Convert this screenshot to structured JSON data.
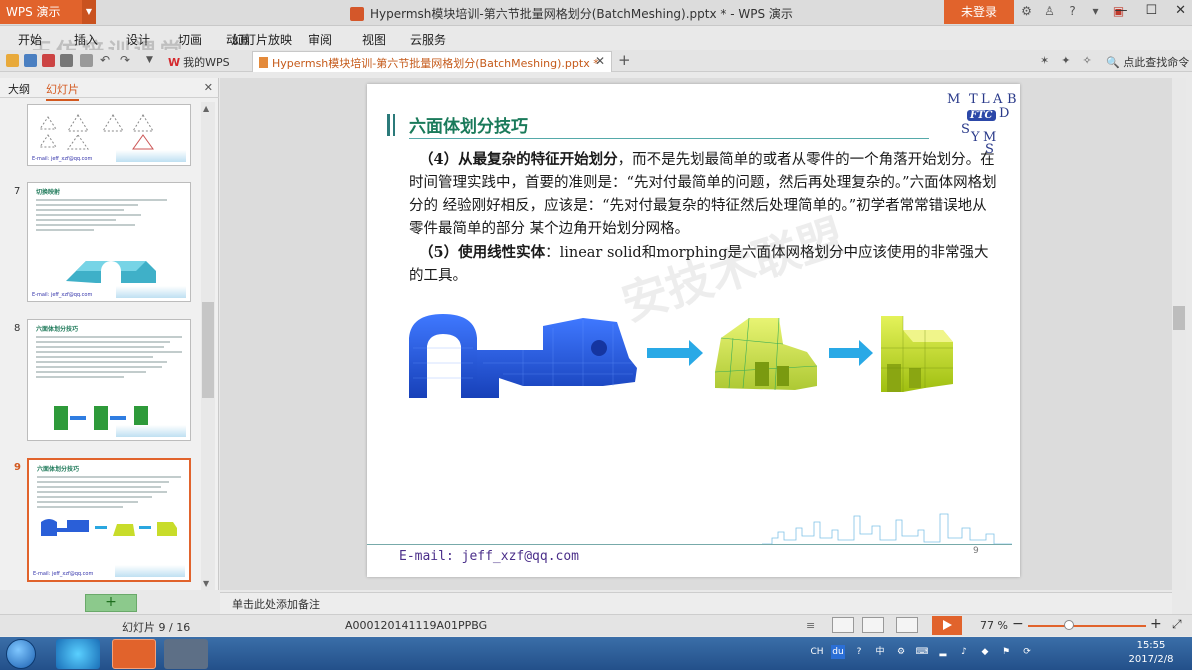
{
  "window": {
    "app_button": "WPS 演示",
    "title": "Hypermsh模块培训-第六节批量网格划分(BatchMeshing).pptx * - WPS 演示",
    "login": "未登录",
    "controls": [
      "—",
      "☐",
      "✕"
    ]
  },
  "menu": {
    "items": [
      "开始",
      "插入",
      "设计",
      "切画",
      "动画",
      "幻灯片放映",
      "审阅",
      "视图",
      "云服务"
    ],
    "watermark": "王仿培训课堂"
  },
  "tabs": {
    "home": "我的WPS",
    "doc": "Hypermsh模块培训-第六节批量网格划分(BatchMeshing).pptx *",
    "search_cmd": "点此查找命令"
  },
  "left_panel": {
    "tab_outline": "大纲",
    "tab_slides": "幻灯片",
    "thumbnails": [
      {
        "num": "",
        "title": "",
        "footer": "E-mail: jeff_xzf@qq.com"
      },
      {
        "num": "7",
        "title": "切换映射",
        "footer": "E-mail: jeff_xzf@qq.com"
      },
      {
        "num": "8",
        "title": "六面体划分技巧",
        "footer": "E-mail: jeff_xzf@qq.com"
      },
      {
        "num": "9",
        "title": "六面体划分技巧",
        "footer": "E-mail: jeff_xzf@qq.com"
      }
    ],
    "add_label": "+"
  },
  "slide": {
    "title": "六面体划分技巧",
    "logo_letters": [
      "M",
      "T",
      "L",
      "A",
      "B",
      "D",
      "S",
      "Y",
      "M",
      "S"
    ],
    "logo_badge": "FTC",
    "para4_bold": "（4）从最复杂的特征开始划分",
    "para4_rest": "，而不是先划最简单的或者从零件的一个角落开始划分。在时间管理实践中，首要的准则是：“先对付最简单的问题，然后再处理复杂的。”六面体网格划分的 经验刚好相反，应该是：“先对付最复杂的特征然后处理简单的。”初学者常常错误地从零件最简单的部分 某个边角开始划分网格。",
    "para5_bold": "（5）使用线性实体",
    "para5_rest": "：linear solid和morphing是六面体网格划分中应该使用的非常强大的工具。",
    "watermark": "安技术联盟",
    "email": "E-mail: jeff_xzf@qq.com",
    "page_number": "9"
  },
  "notes": {
    "placeholder": "单击此处添加备注"
  },
  "status": {
    "slide_counter": "幻灯片 9 / 16",
    "template": "A000120141119A01PPBG",
    "zoom": "77 %",
    "zoom_fraction": 0.35
  },
  "taskbar": {
    "time": "15:55",
    "date": "2017/2/8",
    "tray": [
      "CH",
      "du",
      "?",
      "中",
      "⚙"
    ]
  },
  "colors": {
    "accent": "#e1632c",
    "title_green": "#1a7a5a",
    "mesh_blue": "#2a5fd8",
    "mesh_yellow": "#c8dc2a"
  }
}
